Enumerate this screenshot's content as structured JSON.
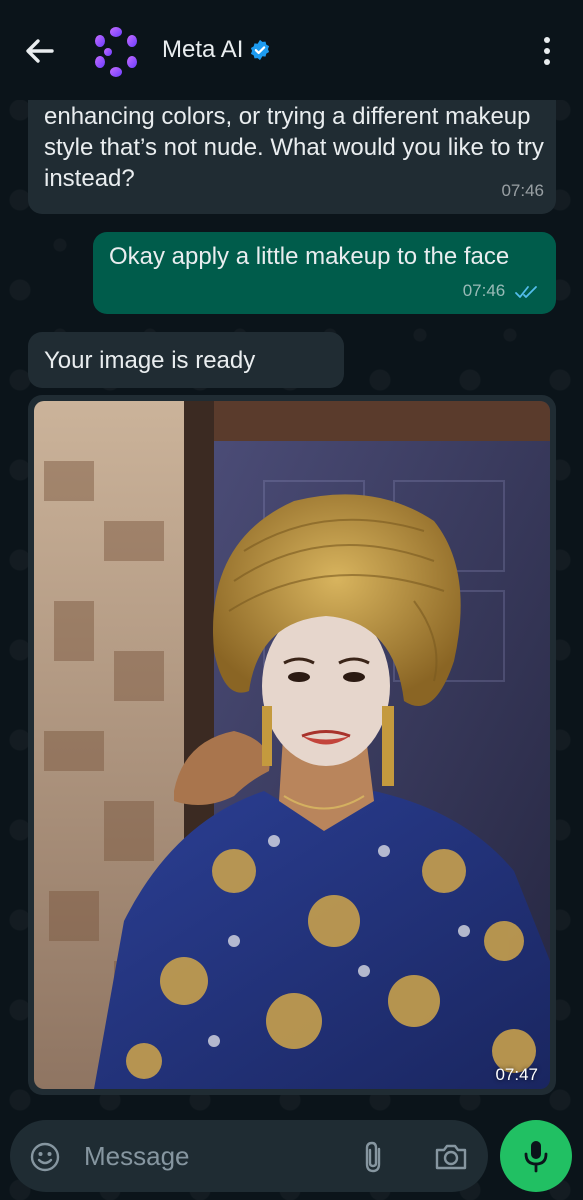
{
  "header": {
    "title": "Meta AI",
    "verified": true
  },
  "messages": [
    {
      "type": "incoming",
      "text": "adjusting lighting, changing the background, enhancing colors, or trying a different makeup style that’s not nude. What would you like to try instead?",
      "time": "07:46"
    },
    {
      "type": "outgoing",
      "text": "Okay apply a little makeup to the face",
      "time": "07:46",
      "status": "read"
    },
    {
      "type": "incoming",
      "text": "Your image is ready"
    },
    {
      "type": "incoming-image",
      "time": "07:47"
    }
  ],
  "composer": {
    "placeholder": "Message"
  },
  "colors": {
    "background": "#0b141a",
    "incoming_bubble": "#202c33",
    "outgoing_bubble": "#005c4b",
    "mic_button": "#21c063",
    "verified_blue": "#1d9bf0",
    "read_ticks": "#53bdeb"
  },
  "icons": [
    "back-arrow-icon",
    "meta-ai-logo-icon",
    "verified-badge-icon",
    "more-options-icon",
    "emoji-icon",
    "attach-icon",
    "camera-icon",
    "mic-icon",
    "read-ticks-icon"
  ]
}
